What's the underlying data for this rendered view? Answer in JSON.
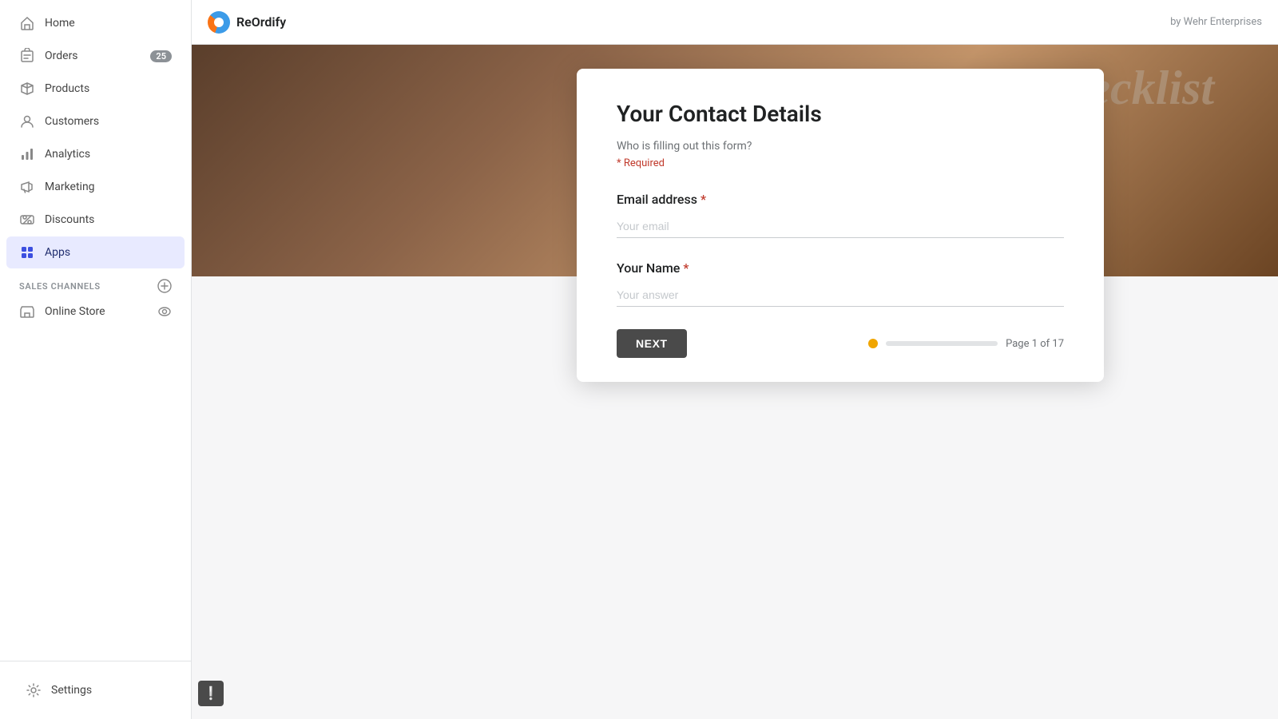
{
  "sidebar": {
    "nav_items": [
      {
        "id": "home",
        "label": "Home",
        "icon": "home",
        "active": false,
        "badge": null
      },
      {
        "id": "orders",
        "label": "Orders",
        "icon": "orders",
        "active": false,
        "badge": "25"
      },
      {
        "id": "products",
        "label": "Products",
        "icon": "products",
        "active": false,
        "badge": null
      },
      {
        "id": "customers",
        "label": "Customers",
        "icon": "customers",
        "active": false,
        "badge": null
      },
      {
        "id": "analytics",
        "label": "Analytics",
        "icon": "analytics",
        "active": false,
        "badge": null
      },
      {
        "id": "marketing",
        "label": "Marketing",
        "icon": "marketing",
        "active": false,
        "badge": null
      },
      {
        "id": "discounts",
        "label": "Discounts",
        "icon": "discounts",
        "active": false,
        "badge": null
      },
      {
        "id": "apps",
        "label": "Apps",
        "icon": "apps",
        "active": true,
        "badge": null
      }
    ],
    "sales_channels_label": "SALES CHANNELS",
    "online_store_label": "Online Store",
    "settings_label": "Settings"
  },
  "topbar": {
    "brand": "ReOrdify",
    "by_text": "by Wehr Enterprises"
  },
  "form": {
    "title": "Your Contact Details",
    "subtitle": "Who is filling out this form?",
    "required_label": "* Required",
    "email_label": "Email address",
    "email_placeholder": "Your email",
    "name_label": "Your Name",
    "name_placeholder": "Your answer",
    "next_button": "NEXT",
    "page_label": "Page 1 of 17"
  }
}
